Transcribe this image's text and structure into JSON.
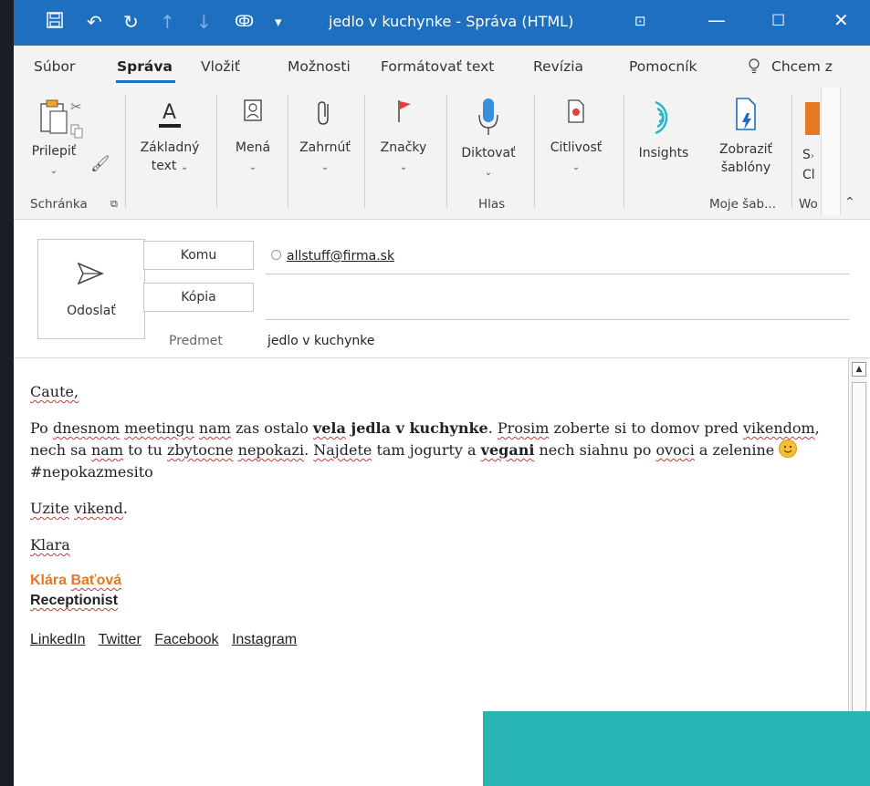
{
  "window": {
    "title": "jedlo v kuchynke  -  Správa (HTML)",
    "accent": "#1e6fc0"
  },
  "tabs": [
    {
      "label": "Súbor"
    },
    {
      "label": "Správa"
    },
    {
      "label": "Vložiť"
    },
    {
      "label": "Možnosti"
    },
    {
      "label": "Formátovať text"
    },
    {
      "label": "Revízia"
    },
    {
      "label": "Pomocník"
    },
    {
      "label": "Chcem z"
    }
  ],
  "ribbon": {
    "paste": "Prilepiť",
    "basic_text_1": "Základný",
    "basic_text_2": "text",
    "names": "Mená",
    "include": "Zahrnúť",
    "tags": "Značky",
    "dictate": "Diktovať",
    "sensitivity": "Citlivosť",
    "insights": "Insights",
    "templates_1": "Zobraziť",
    "templates_2": "šablóny",
    "cut_1": "S",
    "cut_2": "Cl",
    "group_clipboard": "Schránka",
    "group_voice": "Hlas",
    "group_templates": "Moje šab...",
    "group_wo": "Wo"
  },
  "compose": {
    "send": "Odoslať",
    "to_label": "Komu",
    "cc_label": "Kópia",
    "subject_label": "Predmet",
    "to_value": "allstuff@firma.sk",
    "subject_value": "jedlo v kuchynke"
  },
  "body": {
    "greeting": "Caute,",
    "p1_a": "Po ",
    "p1_w1": "dnesnom",
    "p1_sp1": " ",
    "p1_w2": "meetingu",
    "p1_sp2": " ",
    "p1_w3": "nam",
    "p1_b": " zas ostalo ",
    "p1_bold1": "vela",
    "p1_bold2": " jedla v kuchynke",
    "p1_c": ". ",
    "p1_w4": "Prosim",
    "p1_d": " zoberte si to domov pred ",
    "p1_w5": "vikendom",
    "p1_e": ", nech sa ",
    "p1_w6": "nam",
    "p1_f": " to tu ",
    "p1_w7": "zbytocne",
    "p1_sp3": " ",
    "p1_w8": "nepokazi",
    "p1_g": ". ",
    "p1_w9": "Najdete",
    "p1_h": " tam jogurty a ",
    "p1_bold3": "vegani",
    "p1_i": " nech siahnu po ",
    "p1_w10": "ovoci",
    "p1_j": " a zelenine ",
    "hashtag": "#nepokazmesito",
    "closing_w1": "Uzite",
    "closing_sp": " ",
    "closing_w2": "vikend",
    "closing_dot": ".",
    "sign": "Klara"
  },
  "signature": {
    "name_a": "Klára ",
    "name_b": "Baťová",
    "role": "Receptionist",
    "name_color": "#e87722"
  },
  "social": {
    "linkedin": "LinkedIn",
    "twitter": "Twitter",
    "facebook": "Facebook",
    "instagram": "Instagram"
  }
}
